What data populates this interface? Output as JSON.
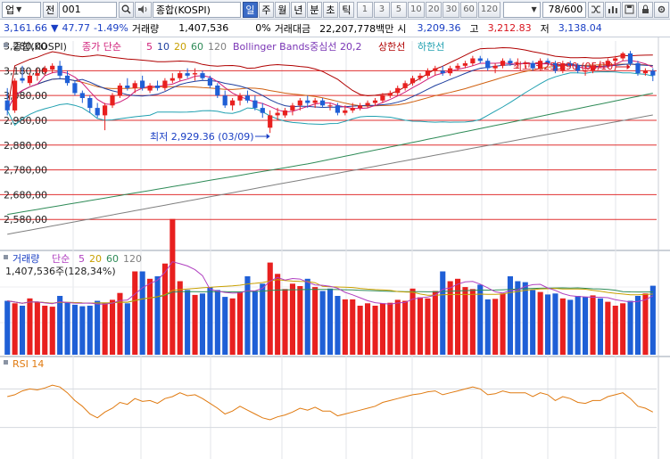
{
  "toolbar": {
    "market_type": "업",
    "all_label": "전",
    "code": "001",
    "search_icon": "search-icon",
    "speaker_icon": "speaker-icon",
    "index_name": "종합(KOSPI)",
    "periods": [
      "일",
      "주",
      "월",
      "년",
      "분",
      "초",
      "틱"
    ],
    "active_period": "일",
    "intervals": [
      "1",
      "3",
      "5",
      "10",
      "20",
      "30",
      "60",
      "120"
    ],
    "page_counter": "78/600"
  },
  "quote": {
    "price": "3,161.66",
    "change": "47.77",
    "change_pct": "-1.49%",
    "volume_label": "거래량",
    "volume": "1,407,536",
    "volume_pct": "0%",
    "amount_label": "거래대금",
    "amount": "22,207,778백만",
    "open_label": "시",
    "open": "3,209.36",
    "high_label": "고",
    "high": "3,212.83",
    "low_label": "저",
    "low": "3,138.04"
  },
  "colors": {
    "up": "#e8201f",
    "down": "#1f5fd6",
    "blue_text": "#1a3fc4",
    "red_text": "#d8141e"
  },
  "chart_data": [
    {
      "type": "candlestick",
      "legend": [
        "종합(KOSPI)",
        "종가 단순",
        "5",
        "10",
        "20",
        "60",
        "120",
        "Bollinger Bands중심선 20,2",
        "상한선",
        "하한선"
      ],
      "y_ticks": [
        "3,280,00",
        "3,180,00",
        "3,080,00",
        "2,980,00",
        "2,880,00",
        "2,780,00",
        "2,680,00",
        "2,580,00"
      ],
      "ylim": [
        2480,
        3300
      ],
      "annotations": {
        "high": {
          "text": "최고 3,255.90 (05/10)",
          "value": 3255.9,
          "index": 83
        },
        "low": {
          "text": "최저 2,929.36 (03/09)",
          "value": 2929.36,
          "index": 35
        }
      },
      "horizontal_levels": [
        3180,
        3080,
        2980,
        2880,
        2780,
        2680,
        2580
      ],
      "series": [
        {
          "name": "OHLC",
          "open": [
            3060,
            3020,
            3150,
            3130,
            3160,
            3175,
            3185,
            3200,
            3160,
            3130,
            3090,
            3070,
            3030,
            3000,
            3040,
            3080,
            3120,
            3110,
            3140,
            3100,
            3120,
            3110,
            3140,
            3150,
            3170,
            3165,
            3170,
            3150,
            3120,
            3080,
            3040,
            3060,
            3080,
            3060,
            3030,
            2950,
            3000,
            3000,
            3020,
            3040,
            3060,
            3050,
            3060,
            3040,
            3040,
            3010,
            3020,
            3030,
            3040,
            3050,
            3060,
            3080,
            3090,
            3110,
            3130,
            3150,
            3160,
            3180,
            3180,
            3170,
            3190,
            3200,
            3210,
            3230,
            3220,
            3190,
            3200,
            3220,
            3210,
            3210,
            3210,
            3190,
            3220,
            3210,
            3180,
            3210,
            3200,
            3180,
            3180,
            3200,
            3200,
            3220,
            3230,
            3250,
            3210,
            3170,
            3180
          ],
          "high": [
            3110,
            3150,
            3200,
            3170,
            3190,
            3200,
            3210,
            3220,
            3180,
            3140,
            3100,
            3080,
            3050,
            3050,
            3090,
            3130,
            3150,
            3140,
            3160,
            3130,
            3140,
            3150,
            3170,
            3180,
            3190,
            3190,
            3180,
            3160,
            3130,
            3100,
            3070,
            3090,
            3100,
            3080,
            3050,
            3020,
            3030,
            3030,
            3050,
            3070,
            3080,
            3070,
            3070,
            3050,
            3050,
            3040,
            3050,
            3050,
            3060,
            3070,
            3090,
            3100,
            3120,
            3140,
            3160,
            3170,
            3190,
            3200,
            3200,
            3200,
            3210,
            3220,
            3240,
            3240,
            3230,
            3210,
            3230,
            3230,
            3230,
            3220,
            3220,
            3230,
            3230,
            3220,
            3220,
            3220,
            3210,
            3200,
            3210,
            3220,
            3230,
            3240,
            3256,
            3260,
            3220,
            3190,
            3190
          ],
          "low": [
            3000,
            3010,
            3130,
            3120,
            3140,
            3160,
            3170,
            3150,
            3120,
            3080,
            3050,
            3010,
            2990,
            2940,
            3030,
            3070,
            3100,
            3090,
            3100,
            3090,
            3100,
            3100,
            3130,
            3140,
            3150,
            3140,
            3140,
            3110,
            3070,
            3030,
            3020,
            3040,
            3050,
            3020,
            2990,
            2929,
            2980,
            2990,
            3000,
            3020,
            3030,
            3030,
            3030,
            3020,
            3000,
            3000,
            3010,
            3020,
            3030,
            3040,
            3050,
            3070,
            3080,
            3100,
            3120,
            3140,
            3150,
            3160,
            3160,
            3160,
            3180,
            3190,
            3200,
            3210,
            3180,
            3170,
            3190,
            3200,
            3190,
            3190,
            3180,
            3180,
            3200,
            3170,
            3170,
            3190,
            3170,
            3160,
            3170,
            3190,
            3190,
            3210,
            3220,
            3200,
            3160,
            3160,
            3138
          ],
          "close": [
            3020,
            3140,
            3140,
            3160,
            3170,
            3190,
            3200,
            3160,
            3130,
            3090,
            3070,
            3030,
            3000,
            3040,
            3080,
            3120,
            3110,
            3130,
            3110,
            3120,
            3110,
            3140,
            3150,
            3170,
            3160,
            3170,
            3150,
            3120,
            3080,
            3040,
            3060,
            3080,
            3060,
            3030,
            3010,
            3000,
            3010,
            3020,
            3040,
            3060,
            3050,
            3060,
            3040,
            3040,
            3010,
            3020,
            3030,
            3040,
            3050,
            3060,
            3080,
            3090,
            3110,
            3130,
            3150,
            3160,
            3180,
            3190,
            3170,
            3190,
            3200,
            3210,
            3230,
            3220,
            3190,
            3200,
            3220,
            3210,
            3210,
            3210,
            3190,
            3220,
            3210,
            3180,
            3210,
            3200,
            3180,
            3180,
            3200,
            3200,
            3220,
            3230,
            3250,
            3210,
            3170,
            3180,
            3161
          ]
        }
      ]
    },
    {
      "type": "bar",
      "legend": [
        "거래량",
        "단순",
        "5",
        "20",
        "60",
        "120"
      ],
      "value_label": "1,407,536주(128,34%)",
      "ylim": [
        0,
        2000000
      ],
      "values": [
        1100000,
        1050000,
        1000000,
        1150000,
        1080000,
        1000000,
        980000,
        1200000,
        1060000,
        1020000,
        990000,
        1000000,
        1100000,
        1050000,
        1120000,
        1260000,
        1050000,
        1700000,
        1700000,
        1550000,
        1600000,
        1860000,
        2770000,
        1500000,
        1320000,
        1220000,
        1250000,
        1380000,
        1320000,
        1180000,
        1150000,
        1280000,
        1600000,
        1300000,
        1450000,
        1880000,
        1650000,
        1340000,
        1450000,
        1400000,
        1550000,
        1380000,
        1300000,
        1350000,
        1200000,
        1130000,
        1130000,
        1000000,
        1050000,
        1000000,
        1050000,
        1060000,
        1120000,
        1100000,
        1350000,
        1170000,
        1150000,
        1300000,
        1700000,
        1500000,
        1550000,
        1380000,
        1340000,
        1430000,
        1130000,
        1140000,
        1250000,
        1600000,
        1500000,
        1480000,
        1320000,
        1280000,
        1230000,
        1250000,
        1150000,
        1120000,
        1200000,
        1180000,
        1210000,
        1150000,
        1080000,
        1000000,
        1050000,
        1100000,
        1200000,
        1250000,
        1407536
      ],
      "up": [
        0,
        1,
        0,
        1,
        1,
        1,
        1,
        0,
        0,
        0,
        0,
        0,
        0,
        1,
        1,
        1,
        0,
        1,
        0,
        1,
        0,
        1,
        1,
        1,
        0,
        1,
        0,
        0,
        0,
        0,
        1,
        1,
        0,
        0,
        0,
        1,
        1,
        1,
        1,
        1,
        0,
        1,
        0,
        0,
        0,
        1,
        1,
        1,
        1,
        1,
        1,
        1,
        1,
        1,
        1,
        1,
        1,
        1,
        0,
        1,
        1,
        1,
        1,
        0,
        0,
        1,
        1,
        0,
        0,
        0,
        0,
        1,
        0,
        0,
        1,
        0,
        0,
        0,
        1,
        0,
        1,
        1,
        1,
        0,
        0,
        1,
        0
      ]
    },
    {
      "type": "line",
      "legend": [
        "RSI 14"
      ],
      "ylim": [
        0,
        100
      ],
      "values": [
        62,
        64,
        68,
        70,
        69,
        71,
        74,
        72,
        66,
        58,
        52,
        44,
        40,
        46,
        50,
        56,
        54,
        60,
        57,
        58,
        55,
        60,
        62,
        66,
        63,
        64,
        60,
        55,
        50,
        44,
        47,
        52,
        48,
        44,
        40,
        38,
        41,
        43,
        46,
        50,
        48,
        51,
        47,
        47,
        42,
        44,
        46,
        48,
        50,
        52,
        56,
        58,
        60,
        62,
        64,
        65,
        67,
        68,
        64,
        66,
        68,
        70,
        72,
        70,
        64,
        65,
        68,
        66,
        66,
        66,
        62,
        66,
        64,
        58,
        62,
        60,
        56,
        55,
        58,
        58,
        62,
        64,
        66,
        60,
        52,
        50,
        46
      ]
    }
  ]
}
